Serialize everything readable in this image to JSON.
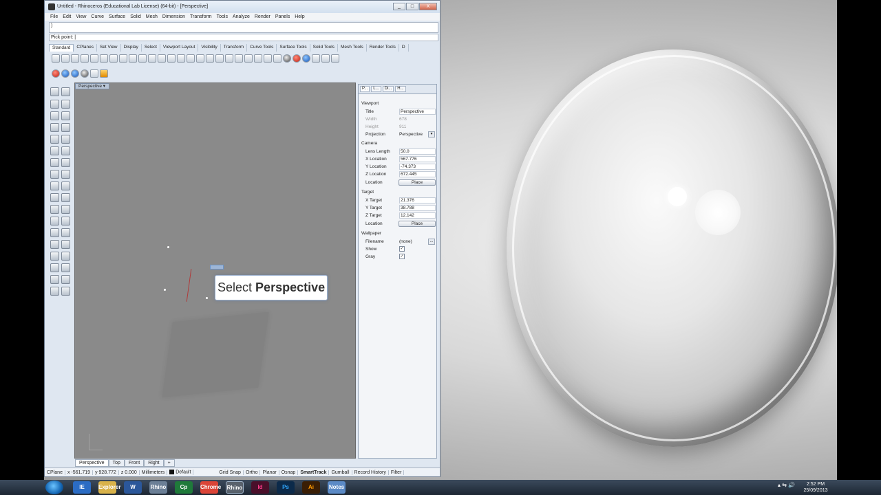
{
  "window": {
    "title": "Untitled - Rhinoceros (Educational Lab License) (64-bit) - [Perspective]",
    "controls": [
      "_",
      "□",
      "X"
    ]
  },
  "menu": [
    "File",
    "Edit",
    "View",
    "Curve",
    "Surface",
    "Solid",
    "Mesh",
    "Dimension",
    "Transform",
    "Tools",
    "Analyze",
    "Render",
    "Panels",
    "Help"
  ],
  "command": {
    "history": ")",
    "prompt": "Pick point"
  },
  "toolbar_tabs": [
    "Standard",
    "CPlanes",
    "Set View",
    "Display",
    "Select",
    "Viewport Layout",
    "Visibility",
    "Transform",
    "Curve Tools",
    "Surface Tools",
    "Solid Tools",
    "Mesh Tools",
    "Render Tools",
    "D"
  ],
  "viewport": {
    "name": "Perspective",
    "tooltip_prefix": "Select",
    "tooltip_bold": "Perspective"
  },
  "viewport_tabs": [
    "Perspective",
    "Top",
    "Front",
    "Right",
    "+"
  ],
  "panel": {
    "tabs": [
      "P...",
      "L...",
      "Di...",
      "H..."
    ],
    "sections": {
      "viewport": "Viewport",
      "camera": "Camera",
      "target": "Target",
      "wallpaper": "Wallpaper"
    },
    "rows": {
      "title_k": "Title",
      "title_v": "Perspective",
      "width_k": "Width",
      "width_v": "678",
      "height_k": "Height",
      "height_v": "911",
      "proj_k": "Projection",
      "proj_v": "Perspective",
      "lens_k": "Lens Length",
      "lens_v": "50.0",
      "xloc_k": "X Location",
      "xloc_v": "567.776",
      "yloc_k": "Y Location",
      "yloc_v": "-74.373",
      "zloc_k": "Z Location",
      "zloc_v": "672.445",
      "loc_k": "Location",
      "place": "Place",
      "xt_k": "X Target",
      "xt_v": "21.376",
      "yt_k": "Y Target",
      "yt_v": "38.788",
      "zt_k": "Z Target",
      "zt_v": "12.142",
      "loc2_k": "Location",
      "file_k": "Filename",
      "file_v": "(none)",
      "file_btn": "...",
      "show_k": "Show",
      "gray_k": "Gray",
      "check": "✓"
    }
  },
  "status": {
    "cplane": "CPlane",
    "x": "x -561.719",
    "y": "y 928.772",
    "z": "z 0.000",
    "units": "Millimeters",
    "layer": "Default",
    "items": [
      "Grid Snap",
      "Ortho",
      "Planar",
      "Osnap",
      "SmartTrack",
      "Gumball",
      "Record History",
      "Filter"
    ]
  },
  "taskbar": {
    "apps": [
      "IE",
      "Explorer",
      "W",
      "Rhino",
      "Cp",
      "Chrome",
      "Rhino",
      "Id",
      "Ps",
      "Ai",
      "Notes"
    ],
    "time": "2:52 PM",
    "date": "25/09/2013"
  },
  "colors": {
    "viewport_bg": "#8a8a8a",
    "accent": "#1467b5"
  }
}
